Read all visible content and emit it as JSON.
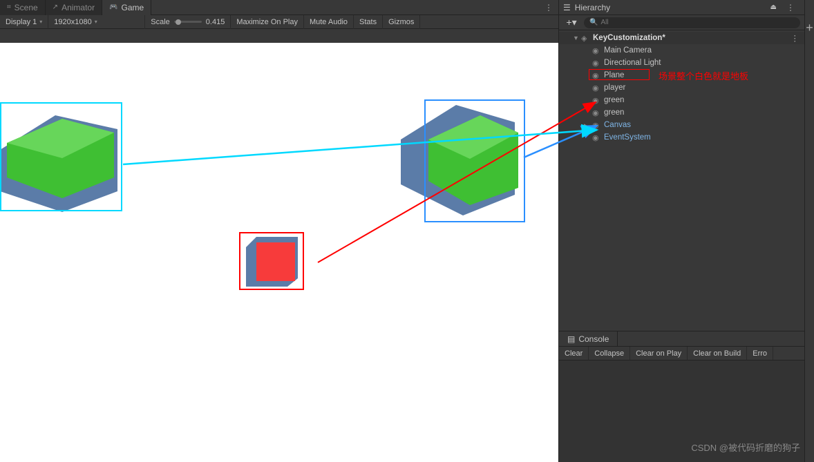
{
  "tabs": {
    "scene": "Scene",
    "animator": "Animator",
    "game": "Game"
  },
  "gameToolbar": {
    "display": "Display 1",
    "resolution": "1920x1080",
    "scaleLabel": "Scale",
    "scaleValue": "0.415",
    "maximize": "Maximize On Play",
    "mute": "Mute Audio",
    "stats": "Stats",
    "gizmos": "Gizmos"
  },
  "hierarchy": {
    "title": "Hierarchy",
    "searchPlaceholder": "All",
    "scene": "KeyCustomization*",
    "items": [
      {
        "label": "Main Camera",
        "prefab": false
      },
      {
        "label": "Directional Light",
        "prefab": false
      },
      {
        "label": "Plane",
        "prefab": false
      },
      {
        "label": "player",
        "prefab": false
      },
      {
        "label": "green",
        "prefab": false
      },
      {
        "label": "green",
        "prefab": false
      },
      {
        "label": "Canvas",
        "prefab": true,
        "hasChildren": true
      },
      {
        "label": "EventSystem",
        "prefab": true
      }
    ]
  },
  "annotation": {
    "planeNote": "场景整个白色就是地板"
  },
  "console": {
    "title": "Console",
    "buttons": [
      "Clear",
      "Collapse",
      "Clear on Play",
      "Clear on Build",
      "Erro"
    ]
  },
  "watermark": "CSDN @被代码折磨的狗子"
}
